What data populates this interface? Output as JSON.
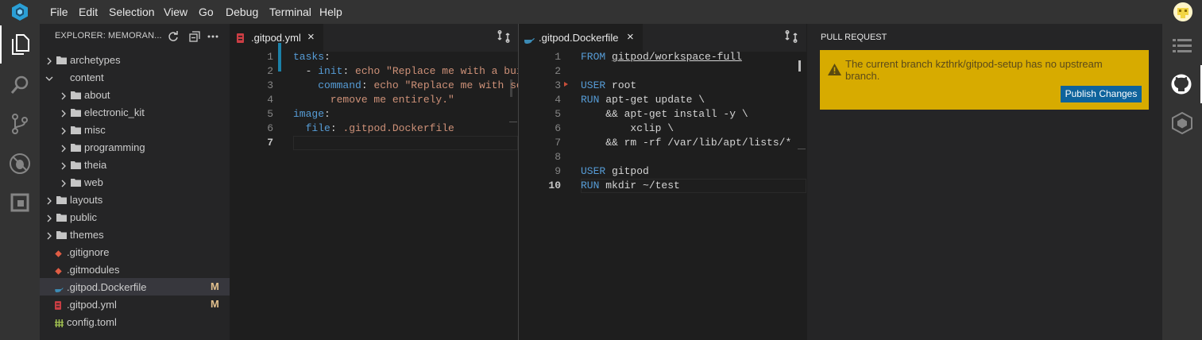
{
  "menu": [
    "File",
    "Edit",
    "Selection",
    "View",
    "Go",
    "Debug",
    "Terminal",
    "Help"
  ],
  "explorer": {
    "title": "EXPLORER: MEMORAN...",
    "items": [
      {
        "label": "archetypes",
        "type": "folder",
        "indent": 0,
        "open": false
      },
      {
        "label": "content",
        "type": "folder",
        "indent": 0,
        "open": true
      },
      {
        "label": "about",
        "type": "folder",
        "indent": 1,
        "open": false
      },
      {
        "label": "electronic_kit",
        "type": "folder",
        "indent": 1,
        "open": false
      },
      {
        "label": "misc",
        "type": "folder",
        "indent": 1,
        "open": false
      },
      {
        "label": "programming",
        "type": "folder",
        "indent": 1,
        "open": false
      },
      {
        "label": "theia",
        "type": "folder",
        "indent": 1,
        "open": false
      },
      {
        "label": "web",
        "type": "folder",
        "indent": 1,
        "open": false
      },
      {
        "label": "layouts",
        "type": "folder",
        "indent": 0,
        "open": false
      },
      {
        "label": "public",
        "type": "folder",
        "indent": 0,
        "open": false
      },
      {
        "label": "themes",
        "type": "folder",
        "indent": 0,
        "open": false
      },
      {
        "label": ".gitignore",
        "type": "git",
        "indent": 0
      },
      {
        "label": ".gitmodules",
        "type": "git",
        "indent": 0
      },
      {
        "label": ".gitpod.Dockerfile",
        "type": "docker",
        "indent": 0,
        "badge": "M",
        "selected": true
      },
      {
        "label": ".gitpod.yml",
        "type": "yml",
        "indent": 0,
        "badge": "M"
      },
      {
        "label": "config.toml",
        "type": "toml",
        "indent": 0
      }
    ]
  },
  "editor1": {
    "tab": ".gitpod.yml",
    "close": "×",
    "lines": [
      "1",
      "2",
      "3",
      "4",
      "5",
      "6",
      "7"
    ],
    "code": [
      [
        {
          "t": "tasks",
          "c": "kw"
        },
        {
          "t": ":",
          "c": "plain"
        }
      ],
      [
        {
          "t": "  - ",
          "c": "plain"
        },
        {
          "t": "init",
          "c": "kw"
        },
        {
          "t": ": ",
          "c": "plain"
        },
        {
          "t": "echo \"Replace me with a build",
          "c": "str"
        }
      ],
      [
        {
          "t": "    ",
          "c": "plain"
        },
        {
          "t": "command",
          "c": "kw"
        },
        {
          "t": ": ",
          "c": "plain"
        },
        {
          "t": "echo \"Replace me with some",
          "c": "str"
        }
      ],
      [
        {
          "t": "      remove me entirely.\"",
          "c": "str"
        }
      ],
      [
        {
          "t": "image",
          "c": "kw"
        },
        {
          "t": ":",
          "c": "plain"
        }
      ],
      [
        {
          "t": "  ",
          "c": "plain"
        },
        {
          "t": "file",
          "c": "kw"
        },
        {
          "t": ": ",
          "c": "plain"
        },
        {
          "t": ".gitpod.Dockerfile",
          "c": "str"
        }
      ],
      []
    ]
  },
  "editor2": {
    "tab": ".gitpod.Dockerfile",
    "close": "×",
    "lines": [
      "1",
      "2",
      "3",
      "4",
      "5",
      "6",
      "7",
      "8",
      "9",
      "10"
    ],
    "code": [
      [
        {
          "t": "FROM ",
          "c": "kw"
        },
        {
          "t": "gitpod/workspace-full",
          "c": "plain",
          "u": true
        }
      ],
      [],
      [
        {
          "t": "USER ",
          "c": "kw"
        },
        {
          "t": "root",
          "c": "plain"
        }
      ],
      [
        {
          "t": "RUN ",
          "c": "kw"
        },
        {
          "t": "apt-get update \\",
          "c": "plain"
        }
      ],
      [
        {
          "t": "    && apt-get install -y \\",
          "c": "plain"
        }
      ],
      [
        {
          "t": "        xclip \\",
          "c": "plain"
        }
      ],
      [
        {
          "t": "    && rm -rf /var/lib/apt/lists/*",
          "c": "plain"
        }
      ],
      [],
      [
        {
          "t": "USER ",
          "c": "kw"
        },
        {
          "t": "gitpod",
          "c": "plain"
        }
      ],
      [
        {
          "t": "RUN ",
          "c": "kw"
        },
        {
          "t": "mkdir ~/test",
          "c": "plain"
        }
      ]
    ]
  },
  "pull_request": {
    "title": "PULL REQUEST",
    "warning": "The current branch kzthrk/gitpod-setup has no upstream branch.",
    "button": "Publish Changes"
  },
  "colors": {
    "warning_bg": "#d7ab00",
    "button_bg": "#0e639c",
    "modified": "#e2c08d"
  }
}
